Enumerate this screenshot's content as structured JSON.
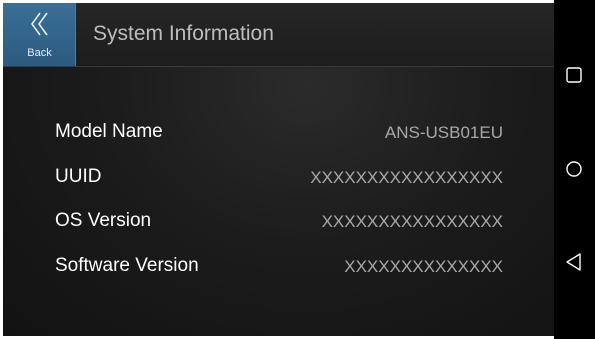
{
  "header": {
    "back_label": "Back",
    "title": "System Information"
  },
  "info": {
    "rows": [
      {
        "label": "Model Name",
        "value": "ANS-USB01EU"
      },
      {
        "label": "UUID",
        "value": "XXXXXXXXXXXXXXXXX"
      },
      {
        "label": "OS Version",
        "value": "XXXXXXXXXXXXXXXX"
      },
      {
        "label": "Software Version",
        "value": "XXXXXXXXXXXXXX"
      }
    ]
  },
  "nav": {
    "recents": "recents-square-icon",
    "home": "home-circle-icon",
    "back": "back-triangle-icon"
  },
  "colors": {
    "back_button": "#2d5a7f",
    "background": "#1c1c1c",
    "label_text": "#ffffff",
    "value_text": "#a8a8a8"
  }
}
